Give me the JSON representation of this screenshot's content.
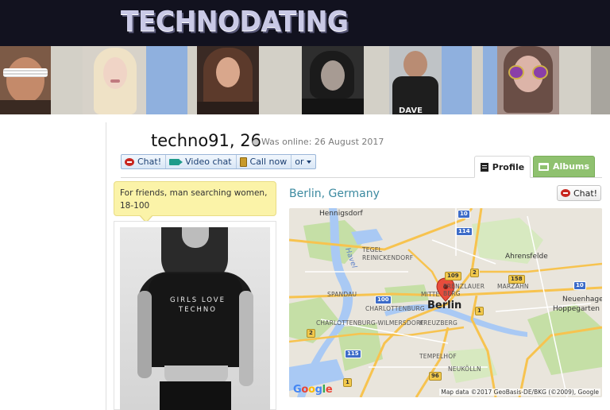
{
  "header": {
    "logo": "TECHNODATING",
    "photo_strip": [
      {
        "name": "strip-photo-man-shutter-shades"
      },
      {
        "name": "strip-photo-blonde-woman"
      },
      {
        "name": "strip-photo-brunette-woman"
      },
      {
        "name": "strip-photo-woman-short-hair"
      },
      {
        "name": "strip-photo-man-back"
      },
      {
        "name": "strip-photo-woman-purple-glasses"
      }
    ],
    "back_shirt_text": "DAVE"
  },
  "profile": {
    "username": "techno91, 26",
    "online_status": "Was online: 26 August 2017",
    "bubble_text": "For friends, man searching women, 18-100",
    "photo_caption": "GIRLS LOVE TECHNO"
  },
  "actions": {
    "chat": "Chat!",
    "video_chat": "Video chat",
    "call_now": "Call now",
    "more": "or"
  },
  "tabs": {
    "profile": "Profile",
    "albums": "Albums"
  },
  "location": {
    "title": "Berlin, Germany",
    "chat_button": "Chat!"
  },
  "map": {
    "labels": {
      "hennigsdorf": "Hennigsdorf",
      "tegel": "TEGEL",
      "reinickendorf": "REINICKENDORF",
      "havel": "Havel",
      "ahrensfelde": "Ahrensfelde",
      "spandau": "SPANDAU",
      "charlottenburg": "CHARLOTTENBURG",
      "mitte": "MITTE",
      "berlin": "Berlin",
      "prenzlauer_berg": "PRENZLAUER BERG",
      "marzahn": "MARZAHN",
      "neuenhagen": "Neuenhage",
      "hoppegarten": "Hoppegarten",
      "charlottenburg_wilmersdorf": "CHARLOTTENBURG-WILMERSDORF",
      "kreuzberg": "KREUZBERG",
      "tempelhof": "TEMPELHOF",
      "neukolln": "NEUKÖLLN"
    },
    "shields": {
      "s10a": "10",
      "s114": "114",
      "s2": "2",
      "s109": "109",
      "s158": "158",
      "s10b": "10",
      "s100": "100",
      "s1a": "1",
      "s2b": "2",
      "s115": "115",
      "s96": "96",
      "s1b": "1"
    },
    "attribution": "Map data ©2017 GeoBasis-DE/BKG (©2009), Google",
    "provider": "Google",
    "colors": {
      "land": "#e9e5dc",
      "park": "#c5dfa6",
      "water": "#a9c9f4",
      "highway": "#f7c34f",
      "road": "#ffffff"
    }
  }
}
